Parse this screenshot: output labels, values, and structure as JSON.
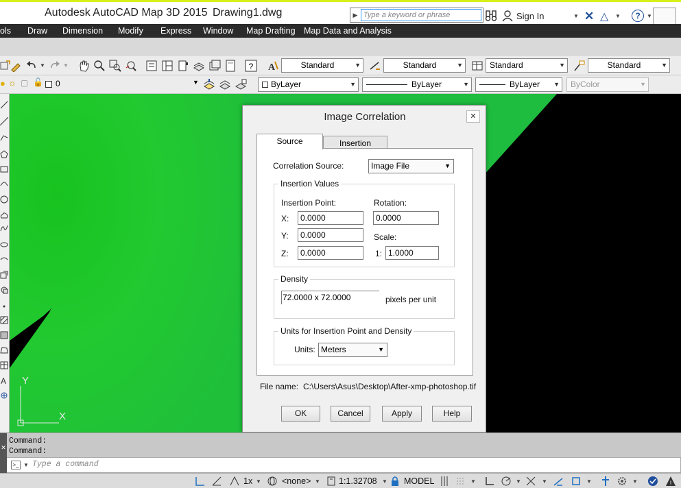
{
  "titlebar": {
    "app_name": "Autodesk AutoCAD Map 3D 2015",
    "document": "Drawing1.dwg",
    "search_placeholder": "Type a keyword or phrase",
    "sign_in": "Sign In"
  },
  "menu": [
    "ols",
    "Draw",
    "Dimension",
    "Modify",
    "Express",
    "Window",
    "Map Drafting",
    "Map Data and Analysis"
  ],
  "toolbar1": {
    "text_style": "Standard",
    "dim_style": "Standard",
    "table_style": "Standard",
    "mleader_style": "Standard"
  },
  "toolbar2": {
    "layer_name": "0",
    "color": "ByLayer",
    "linetype": "ByLayer",
    "lineweight": "ByLayer",
    "plot_style": "ByColor"
  },
  "ucs": {
    "y_label": "Y",
    "x_label": "X"
  },
  "command": {
    "history": [
      "Command:",
      "Command:"
    ],
    "placeholder": "Type a command"
  },
  "statusbar": {
    "scale_factor": "1x",
    "none_label": "<none>",
    "annotation_scale": "1:1.32708",
    "model": "MODEL"
  },
  "dialog": {
    "title": "Image Correlation",
    "tabs": [
      "Source",
      "Insertion"
    ],
    "correlation_source_label": "Correlation Source:",
    "correlation_source": "Image File",
    "insertion_values": {
      "title": "Insertion Values",
      "insertion_point_label": "Insertion Point:",
      "rotation_label": "Rotation:",
      "x_label": "X:",
      "x": "0.0000",
      "y_label": "Y:",
      "y": "0.0000",
      "z_label": "Z:",
      "z": "0.0000",
      "rotation": "0.0000",
      "scale_label": "Scale:",
      "scale_prefix": "1:",
      "scale": "1.0000"
    },
    "density": {
      "title": "Density",
      "value": "72.0000 x 72.0000",
      "unit": "pixels per unit"
    },
    "units_group": {
      "title": "Units for Insertion Point and Density",
      "units_label": "Units:",
      "units": "Meters"
    },
    "file_name_label": "File name:",
    "file_name": "C:\\Users\\Asus\\Desktop\\After-xmp-photoshop.tif",
    "buttons": {
      "ok": "OK",
      "cancel": "Cancel",
      "apply": "Apply",
      "help": "Help"
    }
  },
  "colors": {
    "canvas_green": "#1fc72a",
    "canvas_black": "#000000",
    "menubar": "#2b2b2b",
    "accent": "#d6f01e",
    "help_blue": "#1f4e9c"
  }
}
